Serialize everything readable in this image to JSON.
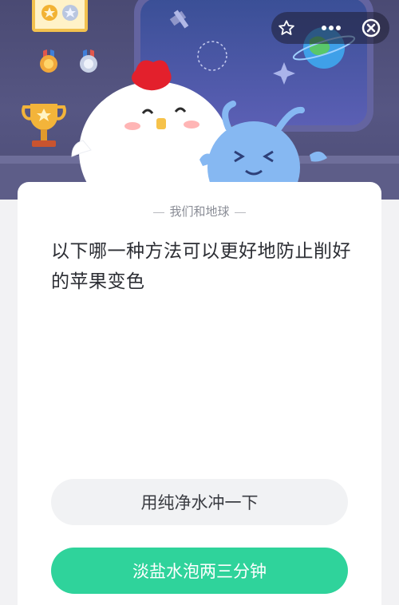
{
  "header": {
    "favorite_icon": "star-outline-icon",
    "more_icon": "ellipsis-icon",
    "close_icon": "close-circle-icon"
  },
  "quiz": {
    "category": "我们和地球",
    "question": "以下哪一种方法可以更好地防止削好的苹果变色",
    "options": [
      {
        "label": "用纯净水冲一下"
      },
      {
        "label": "淡盐水泡两三分钟"
      }
    ]
  },
  "colors": {
    "accent": "#2fd39b",
    "option_bg": "#f1f2f4",
    "banner": "#4f4f7a"
  }
}
